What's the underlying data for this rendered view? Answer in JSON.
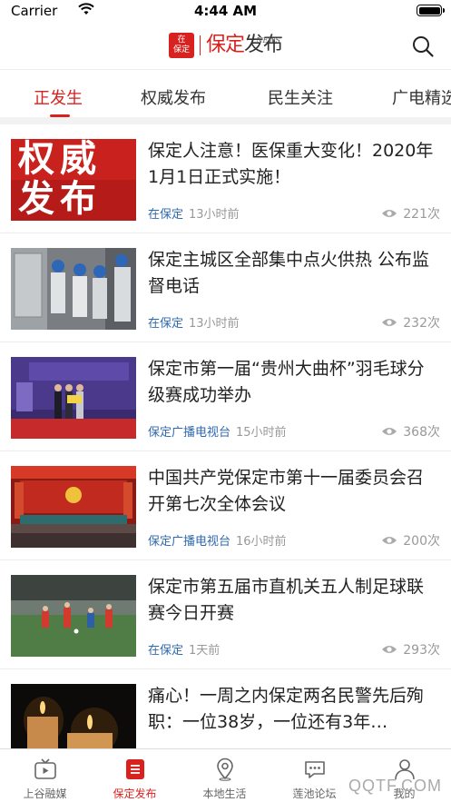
{
  "status_bar": {
    "carrier": "Carrier",
    "time": "4:44 AM"
  },
  "header": {
    "logo_badge_top": "在",
    "logo_badge_bottom": "保定",
    "logo_text_red": "保定",
    "logo_text_dark": "发布",
    "logo_news": "NEWS"
  },
  "tabs": [
    {
      "label": "正发生"
    },
    {
      "label": "权威发布"
    },
    {
      "label": "民生关注"
    },
    {
      "label": "广电精选"
    }
  ],
  "thumb_texts": {
    "line1": "权威",
    "line2": "发布"
  },
  "news": [
    {
      "title": "保定人注意！医保重大变化！2020年1月1日正式实施！",
      "source": "在保定",
      "time": "13小时前",
      "views": "221次"
    },
    {
      "title": "保定主城区全部集中点火供热 公布监督电话",
      "source": "在保定",
      "time": "13小时前",
      "views": "232次"
    },
    {
      "title": "保定市第一届“贵州大曲杯”羽毛球分级赛成功举办",
      "source": "保定广播电视台",
      "time": "15小时前",
      "views": "368次"
    },
    {
      "title": "中国共产党保定市第十一届委员会召开第七次全体会议",
      "source": "保定广播电视台",
      "time": "16小时前",
      "views": "200次"
    },
    {
      "title": "保定市第五届市直机关五人制足球联赛今日开赛",
      "source": "在保定",
      "time": "1天前",
      "views": "293次"
    },
    {
      "title": "痛心！一周之内保定两名民警先后殉职：一位38岁，一位还有3年…"
    }
  ],
  "bottom_nav": [
    {
      "label": "上谷融媒"
    },
    {
      "label": "保定发布"
    },
    {
      "label": "本地生活"
    },
    {
      "label": "莲池论坛"
    },
    {
      "label": "我的"
    }
  ],
  "watermark": "QQTF.COM",
  "colors": {
    "accent": "#d8221f",
    "source_link": "#2f69b0",
    "muted": "#999999"
  }
}
